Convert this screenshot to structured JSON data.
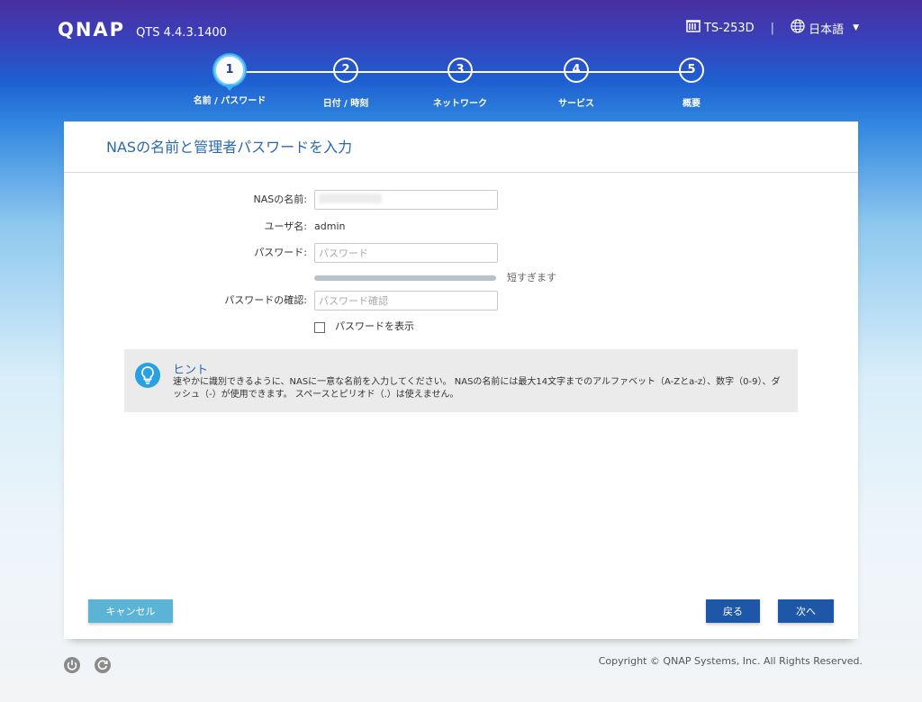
{
  "header": {
    "logo": "QNAP",
    "version": "QTS 4.4.3.1400",
    "model": "TS-253D",
    "separator": "|",
    "language": "日本語",
    "language_caret": "▼"
  },
  "steps": [
    {
      "number": "1",
      "label": "名前 / パスワード",
      "active": true
    },
    {
      "number": "2",
      "label": "日付 / 時刻",
      "active": false
    },
    {
      "number": "3",
      "label": "ネットワーク",
      "active": false
    },
    {
      "number": "4",
      "label": "サービス",
      "active": false
    },
    {
      "number": "5",
      "label": "概要",
      "active": false
    }
  ],
  "panel": {
    "title": "NASの名前と管理者パスワードを入力"
  },
  "form": {
    "nas_name_label": "NASの名前:",
    "nas_name_value": "",
    "username_label": "ユーザ名:",
    "username_value": "admin",
    "password_label": "パスワード:",
    "password_placeholder": "パスワード",
    "strength_text": "短すぎます",
    "confirm_label": "パスワードの確認:",
    "confirm_placeholder": "パスワード確認",
    "show_password_label": "パスワードを表示",
    "show_password_checked": false
  },
  "hint": {
    "title": "ヒント",
    "text": "速やかに識別できるように、NASに一意な名前を入力してください。 NASの名前には最大14文字までのアルファベット（A-Zとa-z）、数字（0-9）、ダッシュ（-）が使用できます。 スペースとピリオド（.）は使えません。"
  },
  "buttons": {
    "cancel": "キャンセル",
    "back": "戻る",
    "next": "次へ"
  },
  "footer": {
    "copyright": "Copyright © QNAP Systems, Inc. All Rights Reserved."
  },
  "colors": {
    "accent": "#2a69b0",
    "primary_button": "#1e56a8",
    "cancel_button": "#5bb3d6"
  }
}
